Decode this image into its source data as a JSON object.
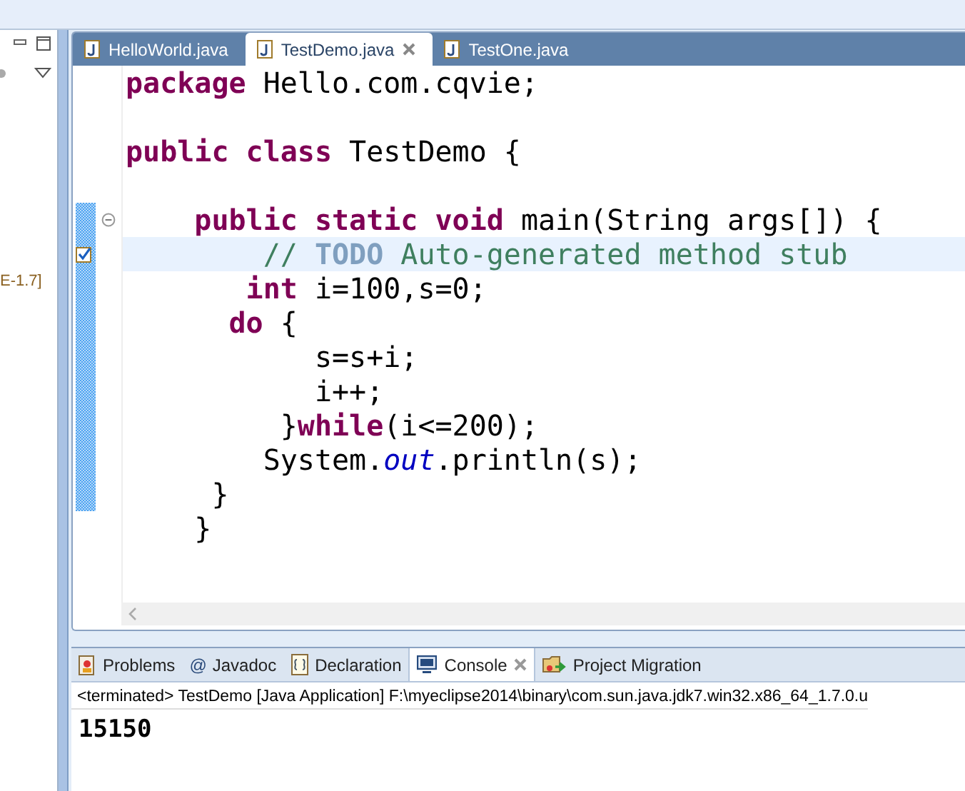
{
  "left_panel": {
    "fragment": "E-1.7]"
  },
  "editor_tabs": [
    {
      "label": "HelloWorld.java",
      "selected": false
    },
    {
      "label": "TestDemo.java",
      "selected": true
    },
    {
      "label": "TestOne.java",
      "selected": false
    }
  ],
  "code_lines": [
    {
      "changed": false,
      "current": false,
      "task_marker": false,
      "fold": false,
      "segments": [
        {
          "kind": "keyword",
          "text": "package"
        },
        {
          "kind": "plain",
          "text": " Hello.com.cqvie;"
        }
      ]
    },
    {
      "changed": false,
      "current": false,
      "task_marker": false,
      "fold": false
    },
    {
      "changed": false,
      "current": false,
      "task_marker": false,
      "fold": false,
      "segments": [
        {
          "kind": "keyword",
          "text": "public class"
        },
        {
          "kind": "plain",
          "text": " TestDemo {"
        }
      ]
    },
    {
      "changed": false,
      "current": false,
      "task_marker": false,
      "fold": false
    },
    {
      "changed": true,
      "current": false,
      "task_marker": false,
      "fold": true,
      "segments": [
        {
          "kind": "keyword",
          "text": "    public static void"
        },
        {
          "kind": "plain",
          "text": " main(String args[]) {"
        }
      ]
    },
    {
      "changed": true,
      "current": true,
      "task_marker": true,
      "fold": false,
      "segments": [
        {
          "kind": "comment",
          "text": "        //"
        },
        {
          "kind": "todo",
          "text": " TODO"
        },
        {
          "kind": "comment",
          "text": " Auto-generated method stub"
        }
      ]
    },
    {
      "changed": true,
      "current": false,
      "task_marker": false,
      "fold": false,
      "segments": [
        {
          "kind": "keyword",
          "text": "       int"
        },
        {
          "kind": "plain",
          "text": " i=100,s=0;"
        }
      ]
    },
    {
      "changed": true,
      "current": false,
      "task_marker": false,
      "fold": false,
      "segments": [
        {
          "kind": "keyword",
          "text": "      do"
        },
        {
          "kind": "plain",
          "text": " {"
        }
      ]
    },
    {
      "changed": true,
      "current": false,
      "task_marker": false,
      "fold": false,
      "segments": [
        {
          "kind": "plain",
          "text": "           s=s+i;"
        }
      ]
    },
    {
      "changed": true,
      "current": false,
      "task_marker": false,
      "fold": false,
      "segments": [
        {
          "kind": "plain",
          "text": "           i++;"
        }
      ]
    },
    {
      "changed": true,
      "current": false,
      "task_marker": false,
      "fold": false,
      "segments": [
        {
          "kind": "plain",
          "text": "         }"
        },
        {
          "kind": "keyword",
          "text": "while"
        },
        {
          "kind": "plain",
          "text": "(i<=200);"
        }
      ]
    },
    {
      "changed": true,
      "current": false,
      "task_marker": false,
      "fold": false,
      "segments": [
        {
          "kind": "plain",
          "text": "        System."
        },
        {
          "kind": "field",
          "text": "out"
        },
        {
          "kind": "plain",
          "text": ".println(s);"
        }
      ]
    },
    {
      "changed": true,
      "current": false,
      "task_marker": false,
      "fold": false,
      "segments": [
        {
          "kind": "plain",
          "text": "     }"
        }
      ]
    },
    {
      "changed": false,
      "current": false,
      "task_marker": false,
      "fold": false,
      "segments": [
        {
          "kind": "plain",
          "text": "    }"
        }
      ]
    }
  ],
  "bottom_tabs": [
    {
      "kind": "problems",
      "label": "Problems",
      "selected": false
    },
    {
      "kind": "javadoc",
      "glyph": "@",
      "label": "Javadoc",
      "selected": false
    },
    {
      "kind": "declaration",
      "label": "Declaration",
      "selected": false
    },
    {
      "kind": "console",
      "label": "Console",
      "selected": true
    },
    {
      "kind": "migration",
      "label": "Project Migration",
      "selected": false
    }
  ],
  "console": {
    "header": "<terminated> TestDemo [Java Application] F:\\myeclipse2014\\binary\\com.sun.java.jdk7.win32.x86_64_1.7.0.u",
    "output": "15150"
  }
}
